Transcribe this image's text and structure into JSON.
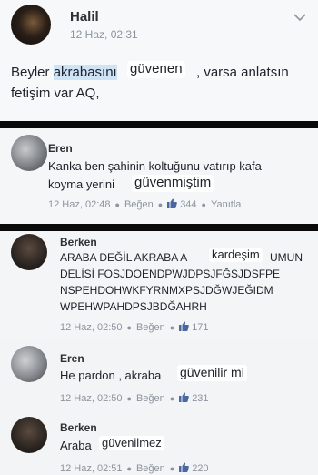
{
  "post": {
    "author": "Halil",
    "timestamp": "12 Haz, 02:31",
    "line1_start": "Beyler ",
    "line1_highlight": "akrabasını",
    "line1_overlay": "güvenen",
    "line1_end": ", varsa anlatsın",
    "line2": "fetişim var AQ,"
  },
  "comments": [
    {
      "author": "Eren",
      "text_line1": "Kanka ben şahinin koltuğunu vatırıp kafa",
      "text_line2": "koyma yerini",
      "overlay": "güvenmiştim",
      "time": "12 Haz, 02:48",
      "like_label": "Beğen",
      "likes": "344",
      "reply_label": "Yanıtla"
    },
    {
      "author": "Berken",
      "text_line1_start": "ARABA DEĞİL AKRABA A",
      "overlay": "kardeşim",
      "text_line1_end": "UMUN",
      "text_line2": "DELİSİ FOSJDOENDPWJDPSJFĞSJDSFPE",
      "text_line3": "NSPEHDOHWKFYRNMXPSJDĞWJEĞIDM",
      "text_line4": "WPEHWPAHDPSJBDĞAHRH",
      "time": "12 Haz, 02:50",
      "like_label": "Beğen",
      "likes": "171"
    },
    {
      "author": "Eren",
      "text_start": "He pardon , akraba",
      "overlay": "güvenilir mi",
      "time": "12 Haz, 02:50",
      "like_label": "Beğen",
      "likes": "231"
    },
    {
      "author": "Berken",
      "text_start": "Araba",
      "overlay": "güvenilmez",
      "time": "12 Haz, 02:51",
      "like_label": "Beğen",
      "likes": "220"
    }
  ],
  "icons": {
    "chevron": "chevron-down-icon",
    "like": "thumbs-up-icon"
  },
  "colors": {
    "link_blue": "#4b67a1",
    "highlight": "#cfe3f7",
    "divider": "#0a0a0a"
  }
}
